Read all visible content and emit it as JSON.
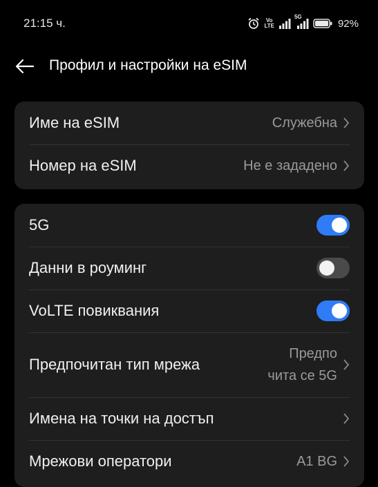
{
  "status_bar": {
    "time": "21:15 ч.",
    "volte_top": "Vo",
    "volte_bottom": "LTE",
    "network_5g": "5G",
    "battery": "92%"
  },
  "header": {
    "title": "Профил и настройки на eSIM"
  },
  "profile_card": {
    "esim_name": {
      "label": "Име на eSIM",
      "value": "Служебна"
    },
    "esim_number": {
      "label": "Номер на eSIM",
      "value": "Не е зададено"
    }
  },
  "settings_card": {
    "five_g": {
      "label": "5G",
      "enabled": true
    },
    "roaming": {
      "label": "Данни в роуминг",
      "enabled": false
    },
    "volte": {
      "label": "VoLTE повиквания",
      "enabled": true
    },
    "network_type": {
      "label": "Предпочитан тип мрежа",
      "value_line1": "Предпо",
      "value_line2": "чита се 5G"
    },
    "apn": {
      "label": "Имена на точки на достъп"
    },
    "operators": {
      "label": "Мрежови оператори",
      "value": "A1 BG"
    }
  },
  "colors": {
    "toggle_on": "#2f7cf6",
    "toggle_off": "#4a4a4a",
    "card_bg": "#1e1e1e"
  }
}
